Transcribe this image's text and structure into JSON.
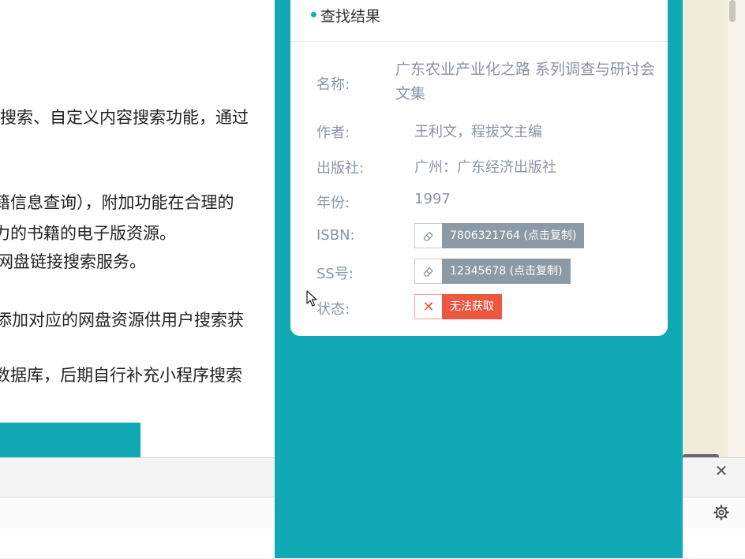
{
  "document": {
    "lines": [
      "搜索、自定义内容搜索功能，通过",
      "籍信息查询），附加功能在合理的",
      "力的书籍的电子版资源。",
      "网盘链接搜索服务。",
      "添加对应的网盘资源供用户搜索获",
      "数据库，后期自行补充小程序搜索"
    ]
  },
  "result_card": {
    "header": "查找结果",
    "name_label": "名称:",
    "name_value": "广东农业产业化之路 系列调查与研讨会文集",
    "author_label": "作者:",
    "author_value": "王利文，程拔文主编",
    "publisher_label": "出版社:",
    "publisher_value": "广州：广东经济出版社",
    "year_label": "年份:",
    "year_value": "1997",
    "isbn_label": "ISBN:",
    "isbn_button": "7806321764 (点击复制)",
    "ss_label": "SS号:",
    "ss_button": "12345678 (点击复制)",
    "status_label": "状态:",
    "status_value": "无法获取"
  },
  "colors": {
    "accent": "#10a9b4",
    "tag_gray": "#8c9aa5",
    "status_red": "#ec5840",
    "label_gray": "#8a96a3"
  },
  "icons": [
    "eraser-icon",
    "close-icon",
    "gear-icon",
    "mouse-cursor-icon"
  ]
}
